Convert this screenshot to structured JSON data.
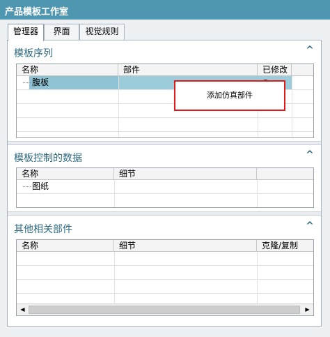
{
  "window": {
    "title": "产品模板工作室"
  },
  "tabs": [
    {
      "label": "管理器",
      "active": true
    },
    {
      "label": "界面",
      "active": false
    },
    {
      "label": "视觉规则",
      "active": false
    }
  ],
  "sections": {
    "template_sequence": {
      "title": "模板序列",
      "columns": [
        "名称",
        "部件",
        "已修改"
      ],
      "rows": [
        {
          "name": "腹板",
          "part": "",
          "selected": true
        }
      ],
      "context_menu": "添加仿真部件"
    },
    "template_controlled_data": {
      "title": "模板控制的数据",
      "columns": [
        "名称",
        "细节",
        ""
      ],
      "rows": [
        {
          "name": "图纸"
        }
      ]
    },
    "other_related_parts": {
      "title": "其他相关部件",
      "columns": [
        "名称",
        "细节",
        "克隆/复制"
      ]
    }
  },
  "icons": {
    "collapse": "chevron-up-icon",
    "scroll_left": "arrow-left-icon",
    "scroll_right": "arrow-right-icon"
  },
  "colors": {
    "titlebar": "#4f97b0",
    "section_title": "#2f6c85",
    "selection": "#8fc3d3",
    "highlight_box": "#e01a1a"
  }
}
